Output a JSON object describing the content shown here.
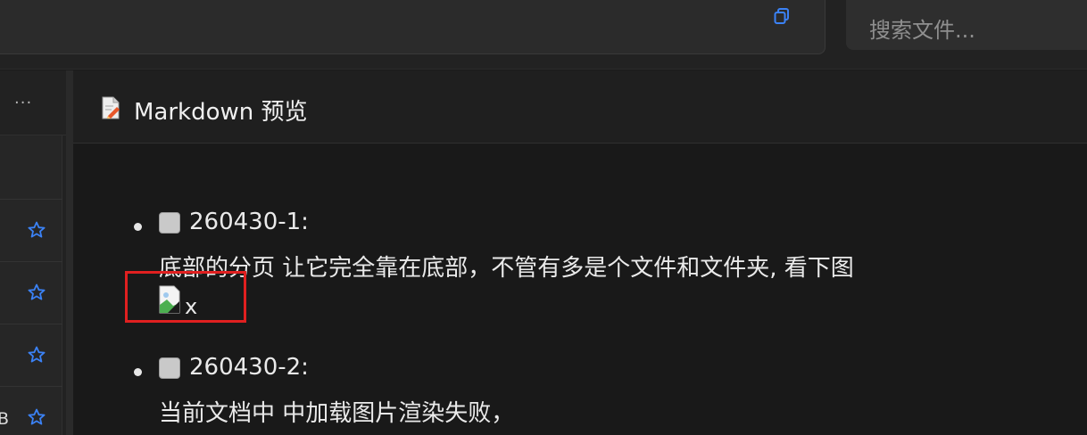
{
  "topbar": {
    "search_placeholder": "搜索文件..."
  },
  "leftpanel": {
    "more_label": "···",
    "rows": [
      {
        "text": ""
      },
      {
        "text": ""
      },
      {
        "text": ""
      },
      {
        "text": "B"
      }
    ]
  },
  "preview": {
    "title": "Markdown 预览",
    "tasks": [
      {
        "title": "260430-1:",
        "description": "底部的分页 让它完全靠在底部，不管有多是个文件和文件夹, 看下图",
        "image_alt": "x"
      },
      {
        "title": "260430-2:",
        "description": "当前文档中 中加载图片渲染失败，"
      }
    ]
  },
  "colors": {
    "accent_blue": "#3b82f6",
    "highlight_red": "#e02020",
    "background": "#1b1b1b"
  },
  "icons": {
    "copy": "copy-icon",
    "star": "star-outline-icon",
    "document": "markdown-document-icon",
    "broken_image": "broken-image-icon"
  }
}
